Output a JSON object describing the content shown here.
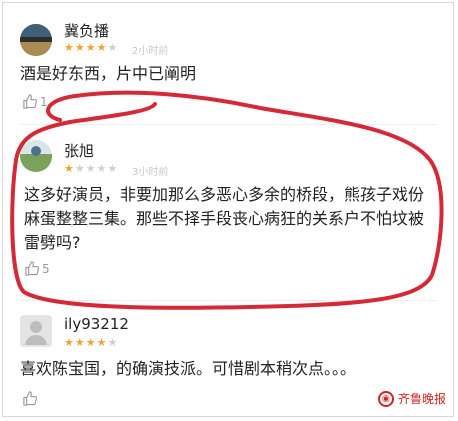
{
  "colors": {
    "highlight_circle": "#d42a38",
    "star_active": "#f2a13a",
    "star_inactive": "#cfcfcf",
    "watermark": "#d42222"
  },
  "comments": [
    {
      "username": "冀负播",
      "rating": 4,
      "rating_max": 5,
      "time": "2小时前",
      "text_lines": [
        "酒是好东西，片中已阐明"
      ],
      "likes": "1",
      "avatar": "avatar-icon"
    },
    {
      "username": "张旭",
      "rating": 1,
      "rating_max": 5,
      "time": "3小时前",
      "text_lines": [
        "这多好演员，非要加那么多恶心多余的桥段，熊孩子戏份",
        "麻蛋整整三集。那些不择手段丧心病狂的关系户不怕坟被",
        "雷劈吗?"
      ],
      "likes": "5",
      "avatar": "avatar-icon"
    },
    {
      "username": "ily93212",
      "rating": 4,
      "rating_max": 5,
      "time": "",
      "text_lines": [
        "喜欢陈宝国，的确演技派。可惜剧本稍次点。。。"
      ],
      "likes": "",
      "avatar": "default-avatar-icon"
    }
  ],
  "watermark": {
    "text": "齐鲁晚报",
    "icon": "wechat-icon"
  }
}
